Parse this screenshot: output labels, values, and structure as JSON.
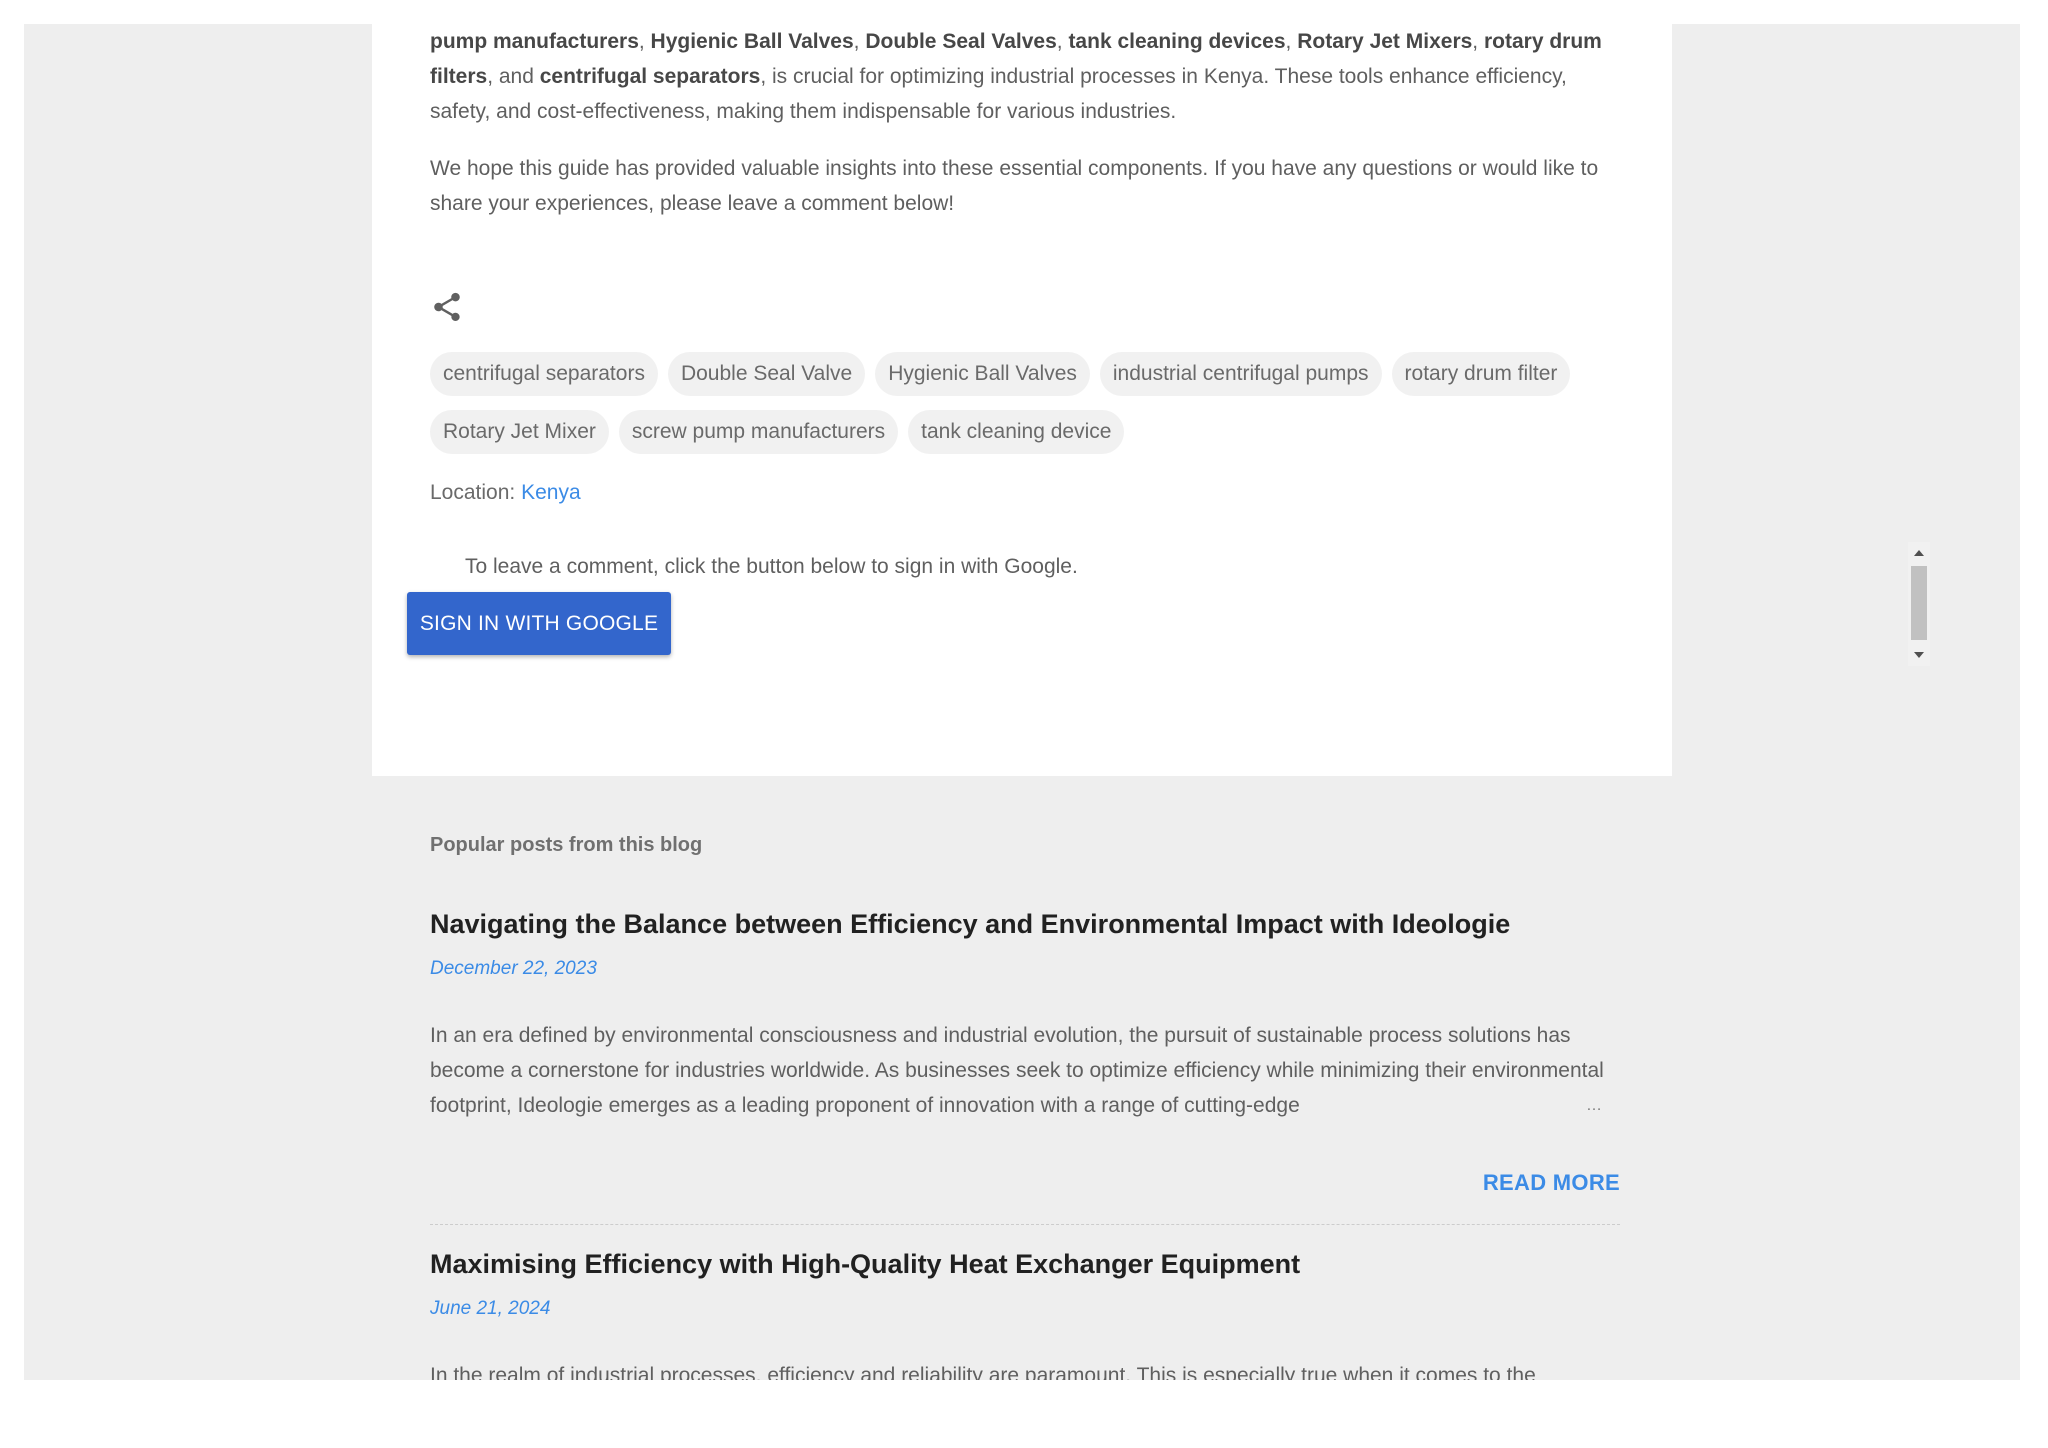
{
  "post": {
    "summary_parts": [
      {
        "text": "pump manufacturers",
        "bold": true
      },
      {
        "text": ", ",
        "bold": false
      },
      {
        "text": "Hygienic Ball Valves",
        "bold": true
      },
      {
        "text": ", ",
        "bold": false
      },
      {
        "text": "Double Seal Valves",
        "bold": true
      },
      {
        "text": ", ",
        "bold": false
      },
      {
        "text": "tank cleaning devices",
        "bold": true
      },
      {
        "text": ", ",
        "bold": false
      },
      {
        "text": "Rotary Jet Mixers",
        "bold": true
      },
      {
        "text": ", ",
        "bold": false
      },
      {
        "text": "rotary drum filters",
        "bold": true
      },
      {
        "text": ", and ",
        "bold": false
      },
      {
        "text": "centrifugal separators",
        "bold": true
      },
      {
        "text": ", is crucial for optimizing industrial processes in Kenya. These tools enhance efficiency, safety, and cost-effectiveness, making them indispensable for various industries.",
        "bold": false
      }
    ],
    "closing": "We hope this guide has provided valuable insights into these essential components. If you have any questions or would like to share your experiences, please leave a comment below!",
    "share_icon": "share-icon",
    "labels": [
      "centrifugal separators",
      "Double Seal Valve",
      "Hygienic Ball Valves",
      "industrial centrifugal pumps",
      "rotary drum filter",
      "Rotary Jet Mixer",
      "screw pump manufacturers",
      "tank cleaning device"
    ],
    "location_label": "Location:",
    "location_value": "Kenya"
  },
  "comments": {
    "prompt": "To leave a comment, click the button below to sign in with Google.",
    "button_label": "SIGN IN WITH GOOGLE"
  },
  "popular": {
    "heading": "Popular posts from this blog",
    "read_more_label": "READ MORE",
    "ellipsis": "…",
    "posts": [
      {
        "title": "Navigating the Balance between Efficiency and Environmental Impact with Ideologie",
        "date": "December 22, 2023",
        "snippet": " In an era defined by environmental consciousness and industrial evolution, the pursuit of sustainable process solutions has become a cornerstone for industries worldwide. As businesses seek to optimize efficiency while minimizing their environmental footprint, Ideologie emerges as a leading proponent of innovation with a range of cutting-edge"
      },
      {
        "title": "Maximising Efficiency with High-Quality Heat Exchanger Equipment",
        "date": "June 21, 2024",
        "snippet": " In the realm of industrial processes, efficiency and reliability are paramount. This is especially true when it comes to the"
      }
    ]
  },
  "colors": {
    "accent_link": "#3b8be6",
    "google_button": "#3366cc",
    "page_background": "#eeeeee",
    "card_background": "#ffffff"
  }
}
